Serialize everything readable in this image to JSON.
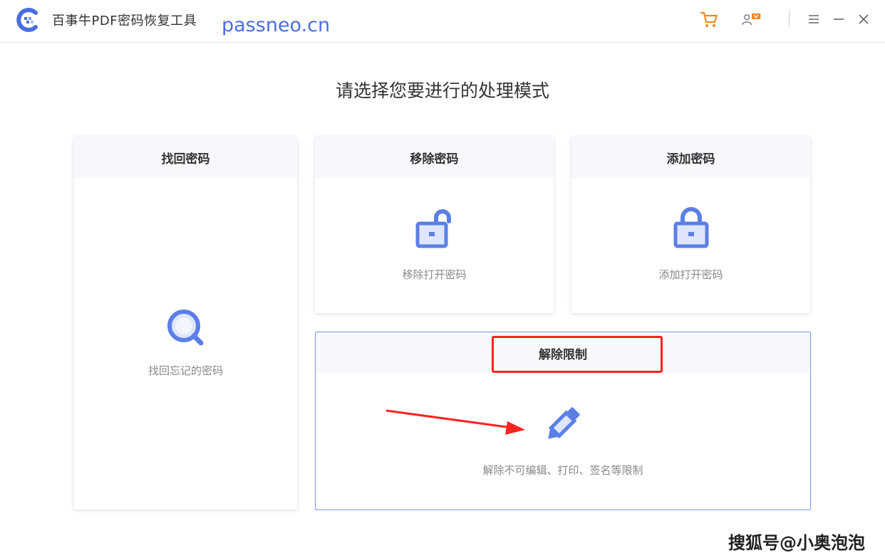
{
  "app": {
    "title": "百事牛PDF密码恢复工具",
    "watermark_url": "passneo.cn",
    "logo_icon": "logo-icon",
    "accent_color": "#4a6ee0"
  },
  "toolbar": {
    "cart_icon": "cart-icon",
    "user_vip_icon": "user-vip-icon",
    "menu_icon": "menu-icon",
    "minimize_icon": "minimize-icon",
    "close_icon": "close-icon"
  },
  "main": {
    "heading": "请选择您要进行的处理模式",
    "cards": {
      "recover": {
        "title": "找回密码",
        "icon": "magnifier-icon",
        "desc": "找回忘记的密码"
      },
      "remove": {
        "title": "移除密码",
        "icon": "unlocked-padlock-icon",
        "desc": "移除打开密码"
      },
      "add": {
        "title": "添加密码",
        "icon": "padlock-icon",
        "desc": "添加打开密码"
      },
      "unlock": {
        "title": "解除限制",
        "icon": "pencil-icon",
        "desc": "解除不可编辑、打印、签名等限制"
      }
    }
  },
  "annotations": {
    "highlight_color": "#ff2222",
    "arrow_color": "#ff2222"
  },
  "footer": {
    "watermark": "搜狐号@小奥泡泡"
  }
}
